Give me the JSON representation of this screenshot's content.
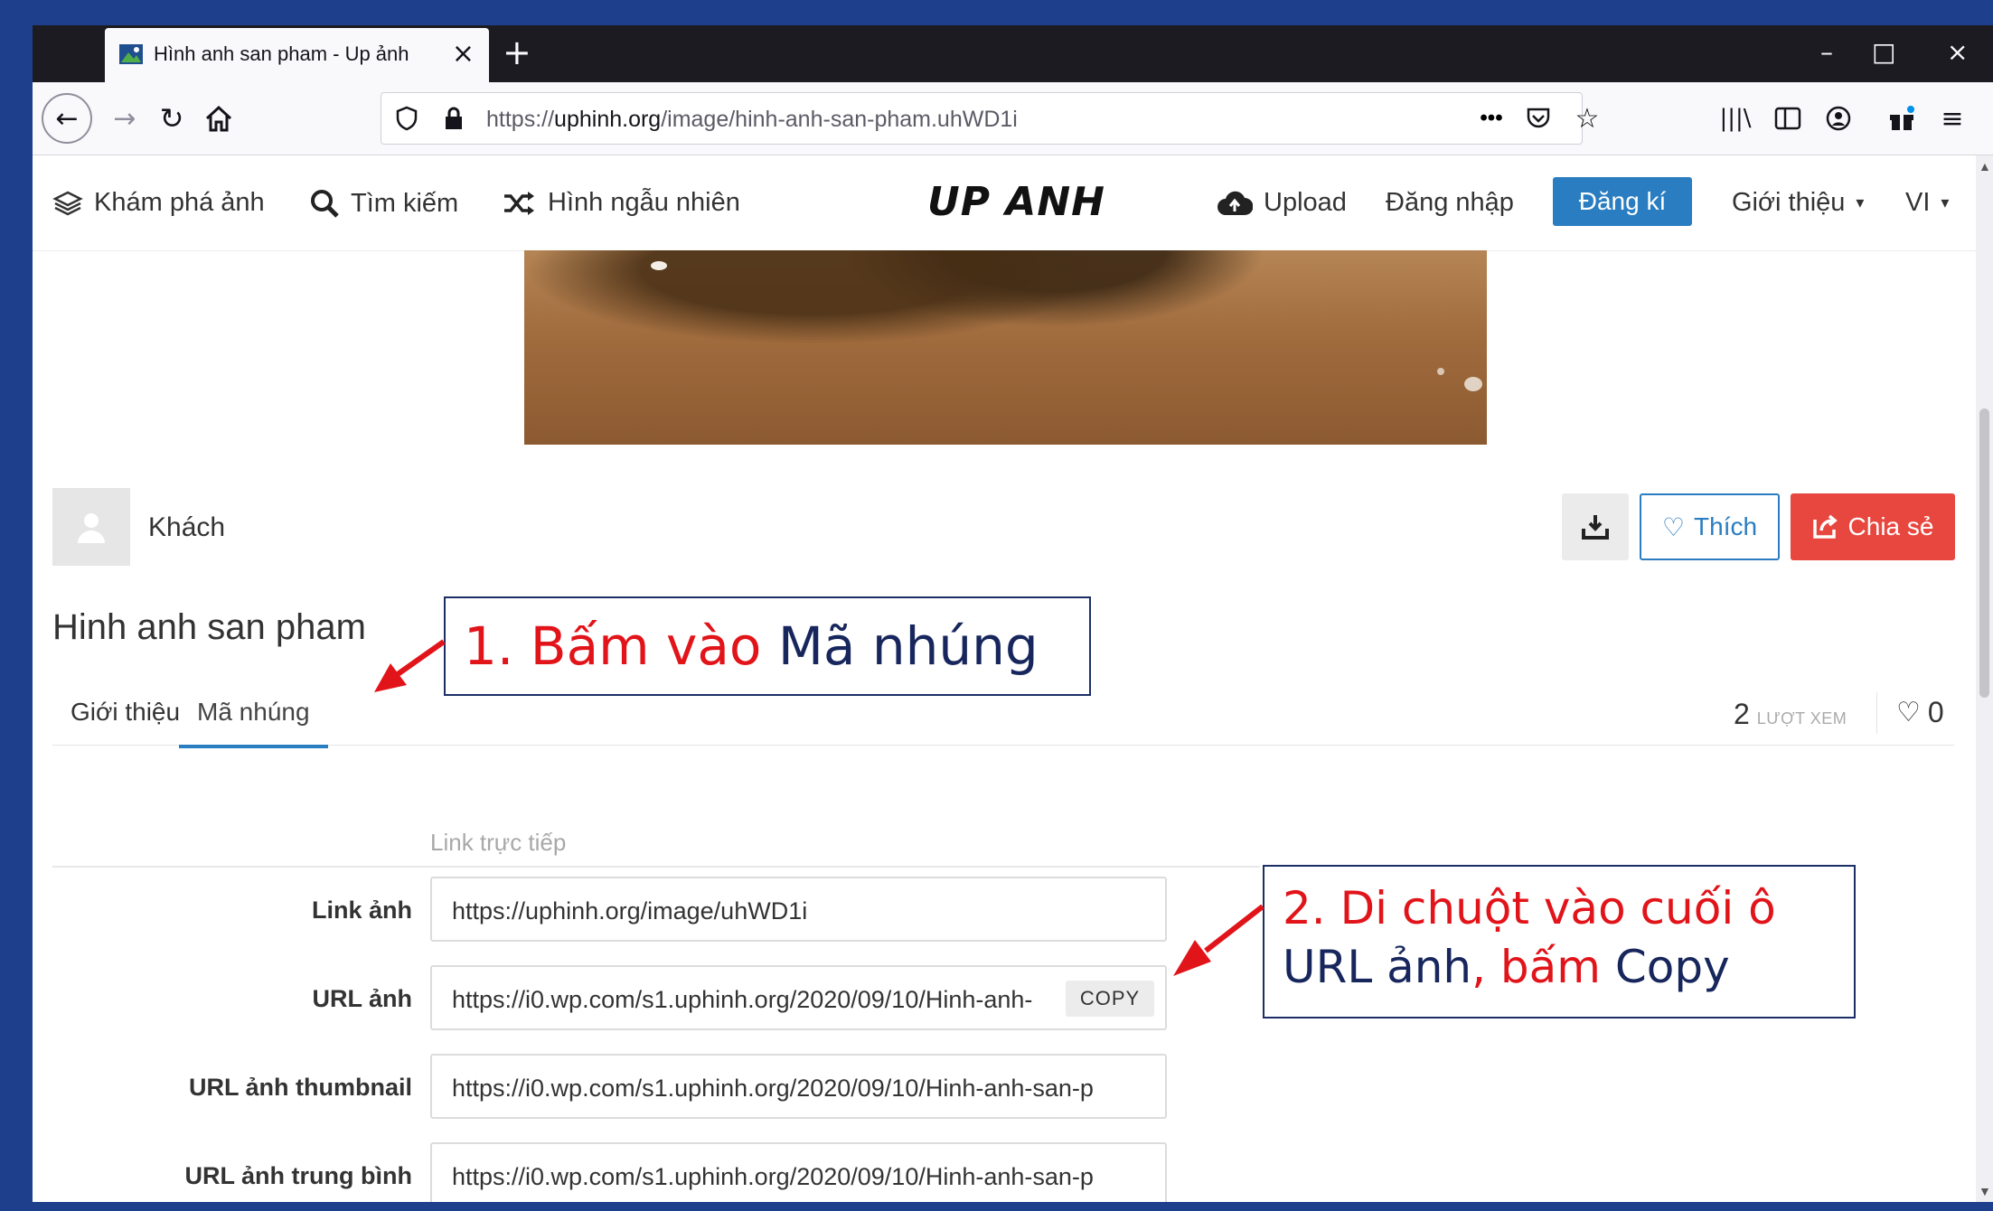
{
  "browser": {
    "tab_title": "Hình anh san pham - Up ảnh",
    "url_prefix": "https://",
    "url_domain": "uphinh.org",
    "url_path": "/image/hinh-anh-san-pham.uhWD1i"
  },
  "header": {
    "explore": "Khám phá ảnh",
    "search": "Tìm kiếm",
    "random": "Hình ngẫu nhiên",
    "logo": "UP ANH",
    "upload": "Upload",
    "login": "Đăng nhập",
    "register": "Đăng kí",
    "about": "Giới thiệu",
    "lang": "VI"
  },
  "user": {
    "name": "Khách"
  },
  "actions": {
    "like": "Thích",
    "share": "Chia sẻ"
  },
  "image": {
    "title": "Hinh anh san pham",
    "tabs": [
      "Giới thiệu",
      "Mã nhúng"
    ],
    "views_count": "2",
    "views_label": "LƯỢT XEM",
    "likes_count": "0"
  },
  "embed": {
    "section_label": "Link trực tiếp",
    "copy_label": "COPY",
    "rows": [
      {
        "label": "Link ảnh",
        "value": "https://uphinh.org/image/uhWD1i"
      },
      {
        "label": "URL ảnh",
        "value": "https://i0.wp.com/s1.uphinh.org/2020/09/10/Hinh-anh-"
      },
      {
        "label": "URL ảnh thumbnail",
        "value": "https://i0.wp.com/s1.uphinh.org/2020/09/10/Hinh-anh-san-p"
      },
      {
        "label": "URL ảnh trung bình",
        "value": "https://i0.wp.com/s1.uphinh.org/2020/09/10/Hinh-anh-san-p"
      }
    ]
  },
  "annotations": {
    "step1_a": "1. Bấm vào ",
    "step1_b": "Mã nhúng",
    "step2_a": "2. Di chuột vào cuối ô",
    "step2_b": "URL ảnh",
    "step2_c": ", bấm ",
    "step2_d": "Copy"
  },
  "colors": {
    "accent": "#2a7dc0",
    "share": "#e8473f",
    "annotation_red": "#e1141a",
    "annotation_blue": "#17265c",
    "frame": "#1d3f8c"
  }
}
